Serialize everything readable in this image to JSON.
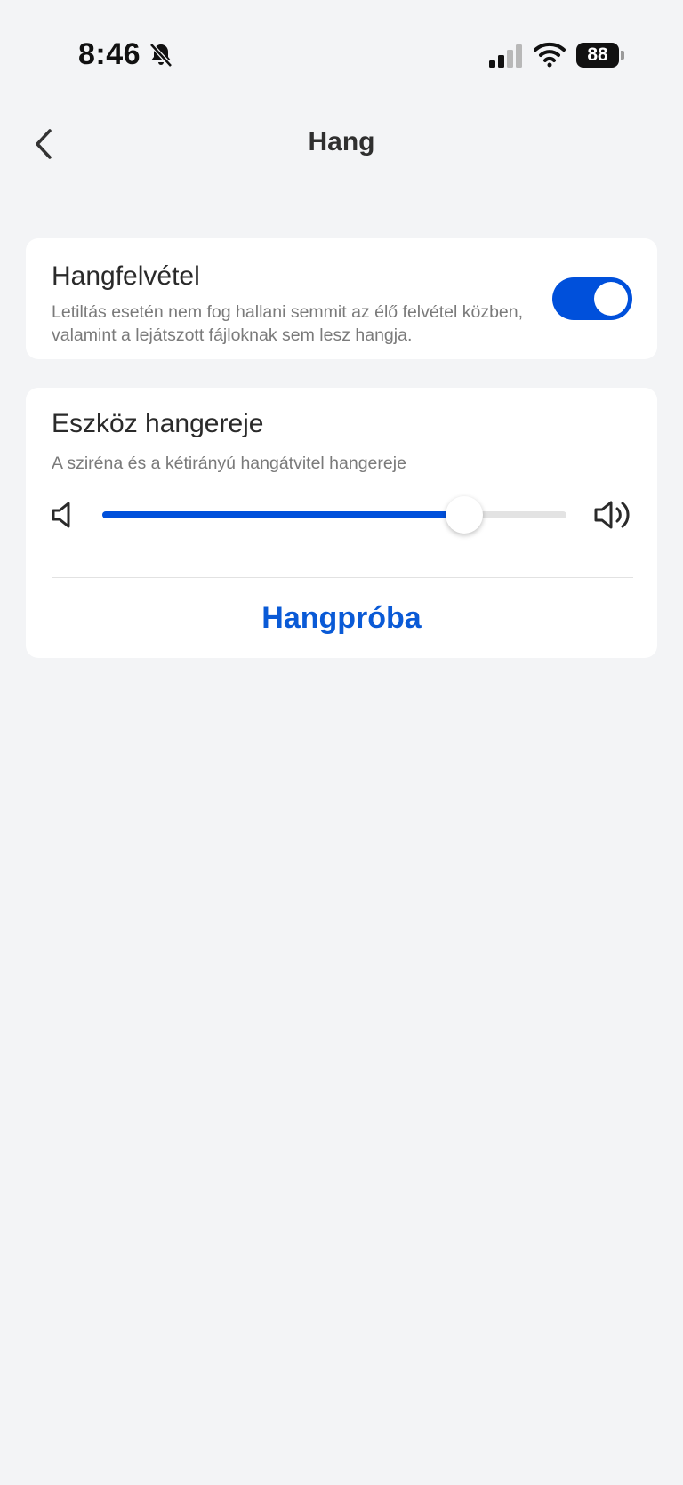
{
  "status_bar": {
    "time": "8:46",
    "battery": "88",
    "icons": [
      "bell-slash-icon",
      "cellular-signal-icon",
      "wifi-icon",
      "battery-icon"
    ]
  },
  "header": {
    "title": "Hang",
    "back_icon": "chevron-left-icon"
  },
  "recording": {
    "title": "Hangfelvétel",
    "description": "Letiltás esetén nem fog hallani semmit az élő felvétel közben, valamint a lejátszott fájloknak sem lesz hangja.",
    "enabled": true
  },
  "volume": {
    "title": "Eszköz hangereje",
    "description": "A sziréna és a kétirányú hangátvitel hangereje",
    "level": 0.78,
    "low_icon": "speaker-low-icon",
    "high_icon": "speaker-high-icon",
    "test_label": "Hangpróba"
  },
  "colors": {
    "accent": "#0050db",
    "link": "#0a5ad6",
    "background": "#f3f4f6",
    "card": "#ffffff"
  }
}
